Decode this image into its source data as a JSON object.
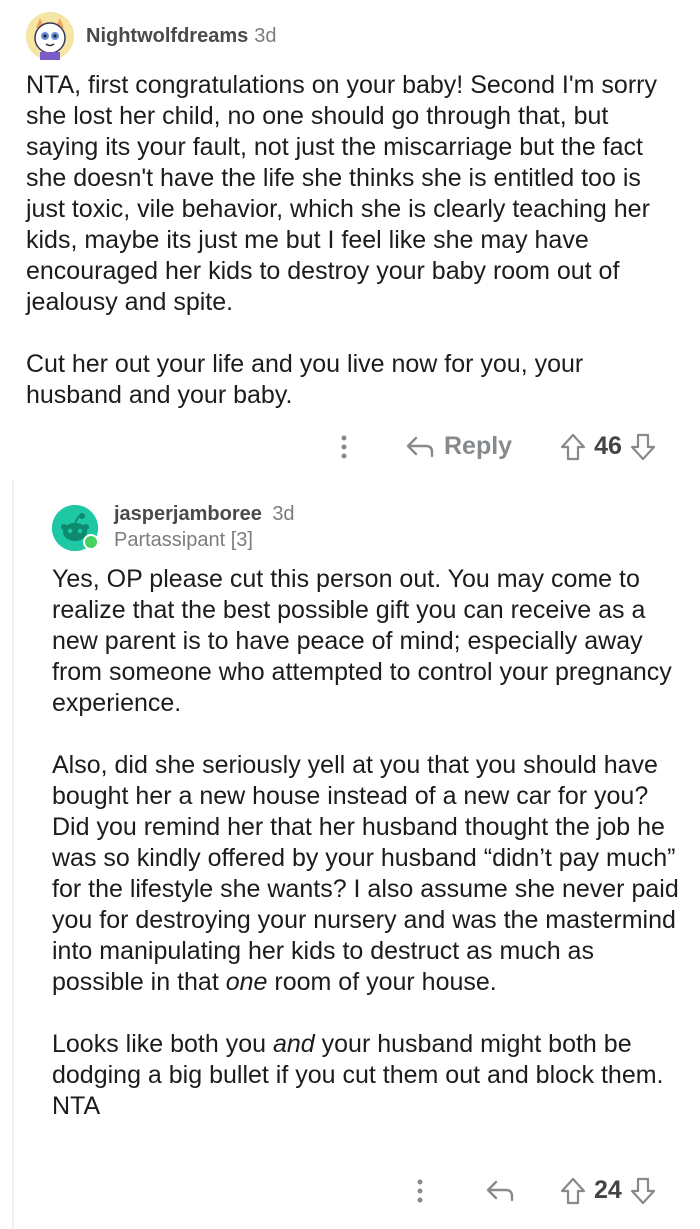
{
  "comments": [
    {
      "username": "Nightwolfdreams",
      "age": "3d",
      "paragraphs": [
        "NTA, first congratulations on your baby! Second I'm sorry she lost her child, no one should go through that, but saying its your fault, not just the miscarriage but the fact she doesn't have the life she thinks she is entitled too is just toxic, vile behavior, which she is clearly teaching her kids, maybe its just me but I feel like she may have encouraged her kids to destroy your baby room out of jealousy and spite.",
        "Cut her out your life and you live now for you, your husband and your baby."
      ],
      "reply_label": "Reply",
      "score": "46",
      "colors": {
        "avatar_bg": "#f4d35e"
      }
    },
    {
      "username": "jasperjamboree",
      "age": "3d",
      "flair": "Partassipant [3]",
      "paragraphs": [
        "Yes, OP please cut this person out. You may come to realize that the best possible gift you can receive as a new parent is to have peace of mind; especially away from someone who attempted to control your pregnancy experience.",
        "Also, did she seriously yell at you that you should have bought her a new house instead of a new car for you? Did you remind her that her husband thought the job he was so kindly offered by your husband “didn’t pay much” for the lifestyle she wants? I also assume she never paid you for destroying your nursery and was the mastermind into manipulating her kids to destruct as much as possible in that",
        "Looks like both you",
        "your husband might both be dodging a big bullet if you cut them out and block them. NTA"
      ],
      "emphasis": {
        "one": "one",
        "room_tail": " room of your house.",
        "and": "and"
      },
      "score": "24",
      "colors": {
        "avatar_bg": "#1fc8a4"
      }
    }
  ],
  "icons": {
    "more": "more-options-icon",
    "reply": "reply-arrow-icon",
    "upvote": "upvote-icon",
    "downvote": "downvote-icon"
  }
}
